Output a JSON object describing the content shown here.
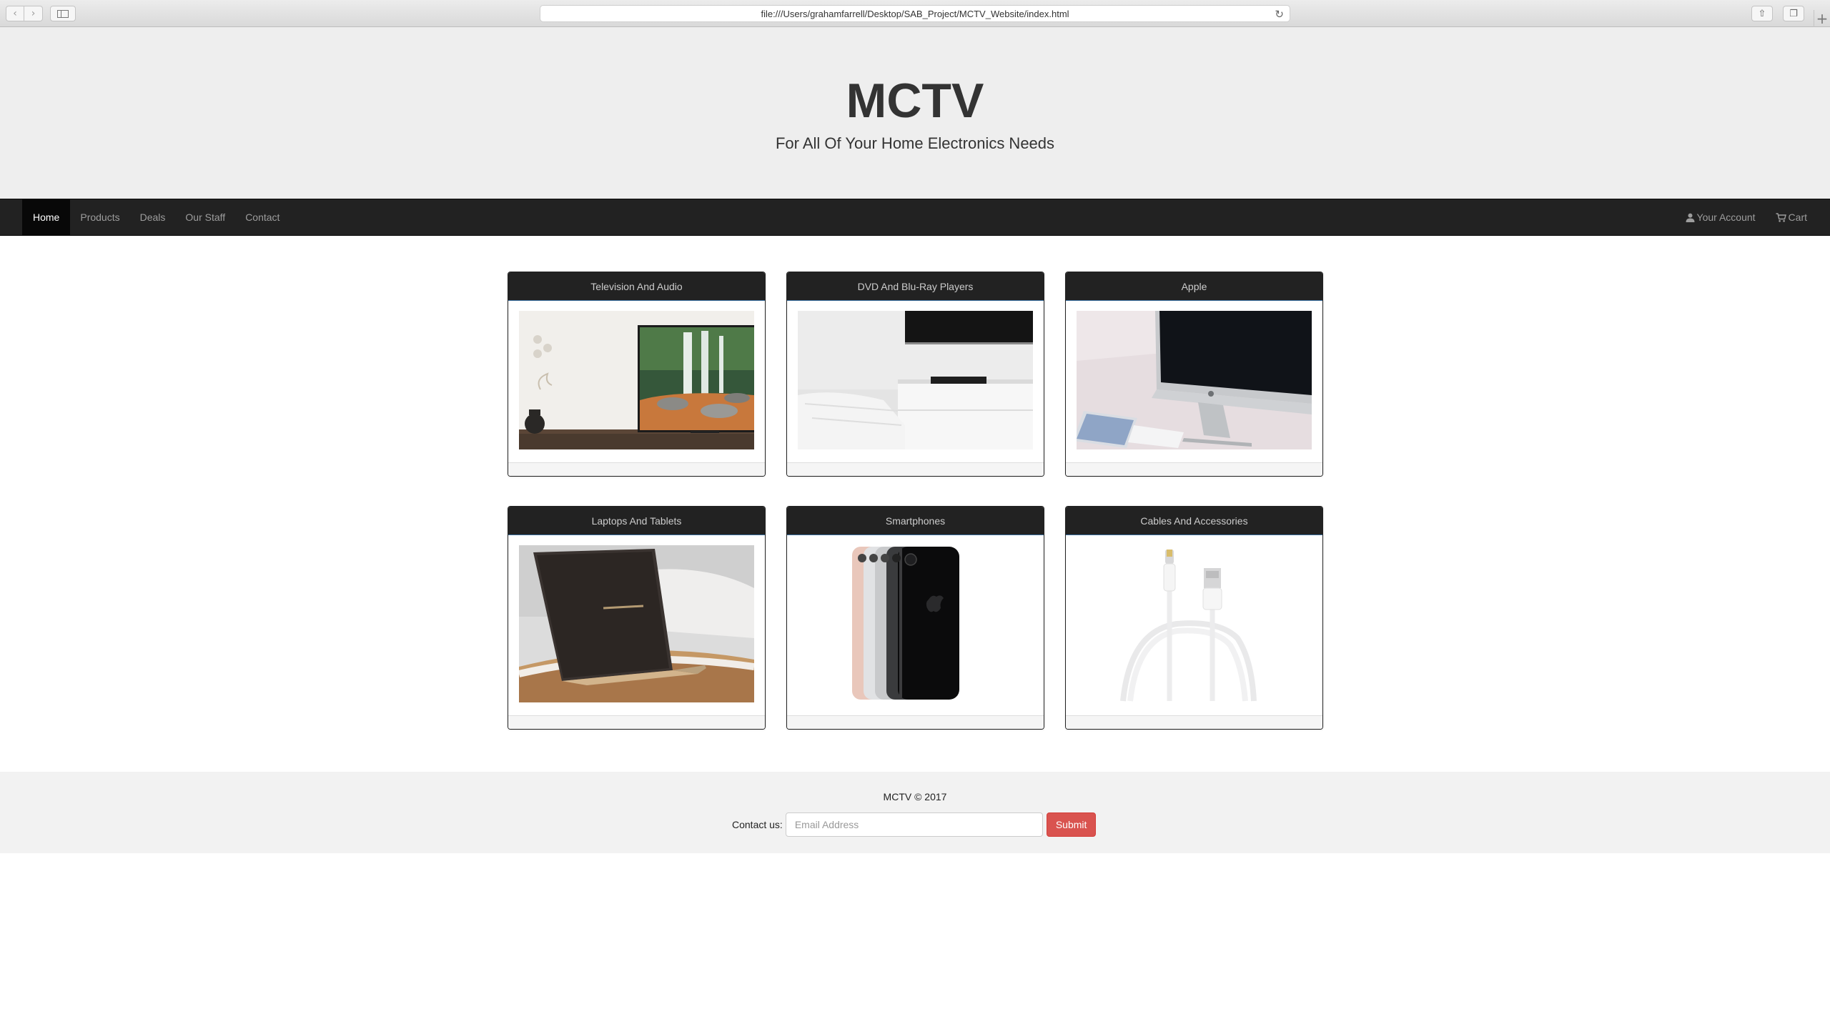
{
  "browser": {
    "url": "file:///Users/grahamfarrell/Desktop/SAB_Project/MCTV_Website/index.html",
    "back_icon": "chevron-left-icon",
    "forward_icon": "chevron-right-icon"
  },
  "header": {
    "title": "MCTV",
    "tagline": "For All Of Your Home Electronics Needs"
  },
  "nav": {
    "left": [
      {
        "label": "Home",
        "active": true
      },
      {
        "label": "Products"
      },
      {
        "label": "Deals"
      },
      {
        "label": "Our Staff"
      },
      {
        "label": "Contact"
      }
    ],
    "right": [
      {
        "label": "Your Account",
        "icon": "user-icon"
      },
      {
        "label": "Cart",
        "icon": "cart-icon"
      }
    ]
  },
  "products": [
    {
      "title": "Television And Audio",
      "image": "tv-image"
    },
    {
      "title": "DVD And Blu-Ray Players",
      "image": "bluray-image"
    },
    {
      "title": "Apple",
      "image": "imac-image"
    },
    {
      "title": "Laptops And Tablets",
      "image": "laptop-image"
    },
    {
      "title": "Smartphones",
      "image": "iphones-image"
    },
    {
      "title": "Cables And Accessories",
      "image": "cable-image"
    }
  ],
  "footer": {
    "copyright": "MCTV © 2017",
    "contact_label": "Contact us:",
    "email_placeholder": "Email Address",
    "submit_label": "Submit"
  },
  "colors": {
    "navbar": "#222222",
    "jumbotron": "#eeeeee",
    "submit": "#d9534f"
  }
}
